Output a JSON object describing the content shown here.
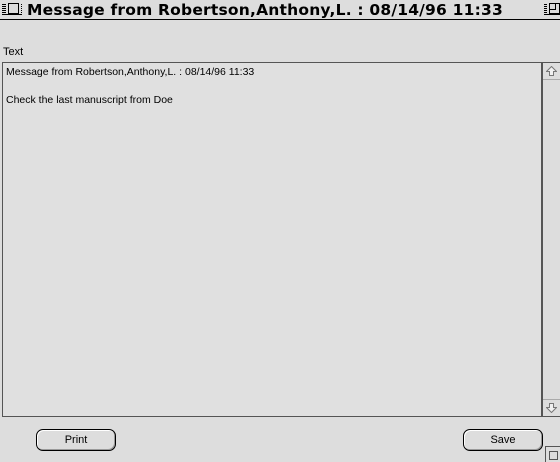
{
  "window": {
    "title": "Message from Robertson,Anthony,L. : 08/14/96 11:33"
  },
  "field": {
    "label": "Text"
  },
  "message": {
    "lines": [
      "Message from Robertson,Anthony,L. : 08/14/96 11:33",
      "",
      "Check the last manuscript from Doe"
    ]
  },
  "buttons": {
    "print_label": "Print",
    "save_label": "Save"
  },
  "icons": {
    "close": "close-box",
    "zoom": "zoom-box",
    "scroll_up": "up-arrow",
    "scroll_down": "down-arrow",
    "grow": "resize-grip"
  },
  "colors": {
    "background": "#dddddd",
    "text": "#000000"
  }
}
